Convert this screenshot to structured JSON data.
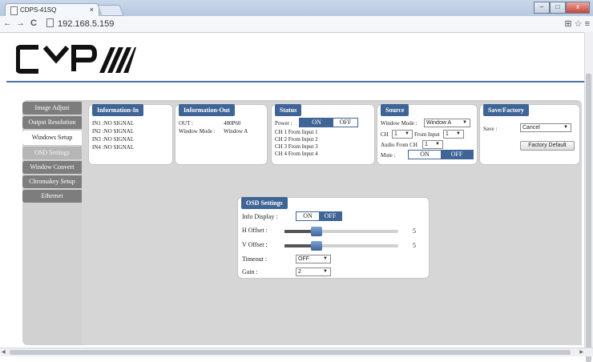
{
  "browser": {
    "tab_title": "CDPS-41SQ",
    "tab_close": "×",
    "back": "←",
    "forward": "→",
    "reload": "C",
    "url": "192.168.5.159",
    "toolbar_icons": "⊞ ☆ ≡",
    "window_buttons": [
      "–",
      "□",
      "x"
    ]
  },
  "brand": {
    "logo_text": "CYP",
    "accent": "#3f6596"
  },
  "sidebar": {
    "items": [
      {
        "label": "Image Adjust",
        "state": "normal"
      },
      {
        "label": "Output Resolution",
        "state": "normal"
      },
      {
        "label": "Windows Setup",
        "state": "active"
      },
      {
        "label": "OSD Settings",
        "state": "dim"
      },
      {
        "label": "Window Convert",
        "state": "normal"
      },
      {
        "label": "Chromakey Setup",
        "state": "normal"
      },
      {
        "label": "Ethernet",
        "state": "normal"
      }
    ]
  },
  "info_in": {
    "title": "Information-In",
    "lines": [
      "IN1 :NO SIGNAL",
      "IN2 :NO SIGNAL",
      "IN3 :NO SIGNAL",
      "IN4 :NO SIGNAL"
    ]
  },
  "info_out": {
    "title": "Information-Out",
    "out_label": "OUT :",
    "out_value": "480P60",
    "mode_label": "Window Mode :",
    "mode_value": "Window A"
  },
  "status": {
    "title": "Status",
    "power_label": "Power :",
    "on": "ON",
    "off": "OFF",
    "channels": [
      "CH 1 From Input  1",
      "CH 2 From Input  2",
      "CH 3 From Input  3",
      "CH 4 From Input  4"
    ]
  },
  "source": {
    "title": "Source",
    "window_mode_label": "Window Mode :",
    "window_mode_value": "Window A",
    "ch_label": "CH",
    "ch_value": "1",
    "from_input_label": "From Input",
    "from_input_value": "1",
    "audio_label": "Audio From CH",
    "audio_value": "1",
    "mute_label": "Mute :",
    "on": "ON",
    "off": "OFF"
  },
  "save_factory": {
    "title": "Save/Factory",
    "save_label": "Save :",
    "save_value": "Cancel",
    "factory_button": "Factory Default"
  },
  "osd": {
    "title": "OSD Settings",
    "info_display_label": "Info Display :",
    "on": "ON",
    "off": "OFF",
    "h_offset_label": "H Offset :",
    "h_offset_value": "5",
    "h_offset_level": 0.28,
    "v_offset_label": "V Offset :",
    "v_offset_value": "5",
    "v_offset_level": 0.28,
    "timeout_label": "Timeout :",
    "timeout_value": "OFF",
    "gain_label": "Gain :",
    "gain_value": "2"
  }
}
